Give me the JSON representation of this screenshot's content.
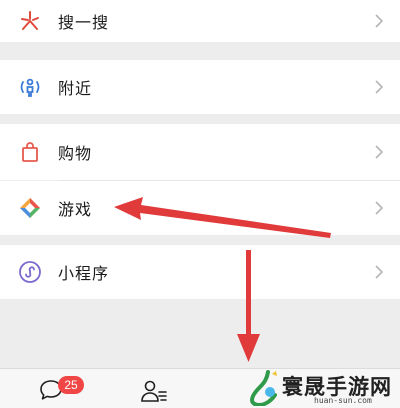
{
  "menu": {
    "search": {
      "label": "搜一搜",
      "icon": "search-sparkle-icon"
    },
    "nearby": {
      "label": "附近",
      "icon": "nearby-person-icon"
    },
    "shopping": {
      "label": "购物",
      "icon": "shopping-bag-icon"
    },
    "games": {
      "label": "游戏",
      "icon": "game-diamond-icon"
    },
    "mini_programs": {
      "label": "小程序",
      "icon": "mini-program-icon"
    }
  },
  "tabbar": {
    "chats_badge": "25",
    "items": [
      "chat-bubble-icon",
      "contacts-icon"
    ]
  },
  "watermark": {
    "text": "寰晟手游网",
    "subtext": "huan-sun.com"
  },
  "colors": {
    "accent_red": "#e03a3a",
    "background": "#ededed",
    "row": "#ffffff"
  }
}
